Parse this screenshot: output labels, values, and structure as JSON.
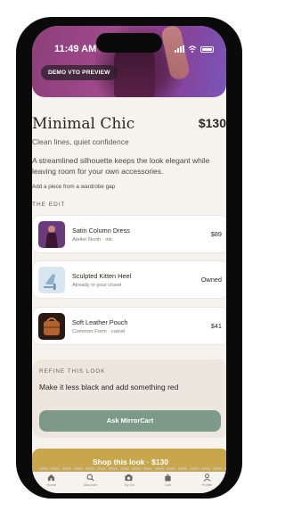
{
  "status_bar": {
    "time": "11:49 AM"
  },
  "hero": {
    "badge": "DEMO VTO PREVIEW"
  },
  "look": {
    "title": "Minimal Chic",
    "price": "$130",
    "subtitle": "Clean lines, quiet confidence",
    "description": "A streamlined silhouette keeps the look elegant while leaving room for your own accessories.",
    "gap_note": "Add a piece from a wardrobe gap"
  },
  "edit": {
    "section_label": "THE EDIT",
    "items": [
      {
        "name": "Satin Column Dress",
        "meta": "Atelier North · ink",
        "right": "$89",
        "thumb_icon": "dress-thumbnail",
        "thumb_color": "#3b1630"
      },
      {
        "name": "Sculpted Kitten Heel",
        "meta": "Already in your closet",
        "right": "Owned",
        "thumb_icon": "heel-thumbnail",
        "thumb_color": "#8fb1c9"
      },
      {
        "name": "Soft Leather Pouch",
        "meta": "Common Form · camel",
        "right": "$41",
        "thumb_icon": "pouch-thumbnail",
        "thumb_color": "#b0622f"
      }
    ]
  },
  "refine": {
    "label": "REFINE THIS LOOK",
    "input_value": "Make it less black and add something red",
    "ask_button": "Ask MirrorCart"
  },
  "shop_button": "Shop this look · $130",
  "tabbar": {
    "tabs": [
      {
        "label": "Home",
        "icon": "home-icon"
      },
      {
        "label": "Discover",
        "icon": "search-icon"
      },
      {
        "label": "Try On",
        "icon": "camera-icon"
      },
      {
        "label": "Cart",
        "icon": "bag-icon"
      },
      {
        "label": "Profile",
        "icon": "profile-icon"
      }
    ]
  },
  "colors": {
    "background": "#f6f3ee",
    "accent_gold": "#c7a64c",
    "accent_sage": "#7c9a87",
    "refine_panel": "#ece6de"
  }
}
